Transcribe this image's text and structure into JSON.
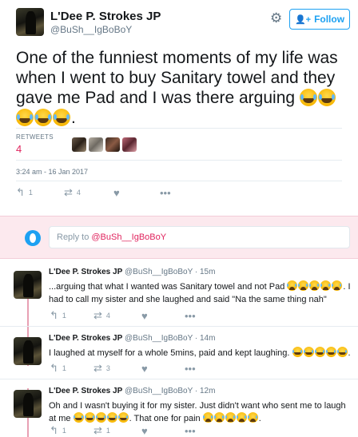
{
  "main_tweet": {
    "display_name": "L'Dee P. Strokes JP",
    "handle": "@BuSh__IgBoBoY",
    "follow_label": "Follow",
    "text_line": "One of the funniest moments of my life was when I went to buy Sanitary towel and they gave me Pad and I was there arguing",
    "text_end": ".",
    "retweets_label": "RETWEETS",
    "retweets_count": "4",
    "timestamp": "3:24 am - 16 Jan 2017",
    "actions": {
      "reply_count": "1",
      "retweet_count": "4",
      "like_count": "",
      "more": "•••"
    }
  },
  "reply_box": {
    "prefix": "Reply to",
    "mention": "@BuSh__IgBoBoY"
  },
  "replies": [
    {
      "name": "L'Dee P. Strokes JP",
      "meta": "@BuSh__IgBoBoY · 15m",
      "text_a": "...arguing that what I wanted was Sanitary towel and not Pad",
      "text_b": ". I had to call my sister and she laughed and said \"Na the same thing nah\"",
      "reply_count": "1",
      "retweet_count": "4",
      "like_count": "",
      "more": "•••"
    },
    {
      "name": "L'Dee P. Strokes JP",
      "meta": "@BuSh__IgBoBoY · 14m",
      "text_a": "I laughed at myself for a whole 5mins, paid and kept laughing.",
      "text_b": ".",
      "reply_count": "1",
      "retweet_count": "3",
      "like_count": "",
      "more": "•••"
    },
    {
      "name": "L'Dee P. Strokes JP",
      "meta": "@BuSh__IgBoBoY · 12m",
      "text_a": "Oh and I wasn't buying it for my sister. Just didn't want who sent me to laugh at me",
      "text_b": ". That one for pain",
      "text_c": ".",
      "reply_count": "1",
      "retweet_count": "1",
      "like_count": "",
      "more": "•••"
    }
  ],
  "icons": {
    "gear": "gear-icon",
    "follow": "add-user-icon",
    "reply": "reply-icon",
    "retweet": "retweet-icon",
    "like": "heart-icon",
    "more": "more-icon",
    "emoji_main": "tears-of-joy-emoji",
    "emoji_cry": "loudly-crying-emoji"
  },
  "colors": {
    "accent": "#1da1f2",
    "retweet_count": "#e0245e",
    "reply_bar_bg": "#fce9ee",
    "thread_line": "#e8a0b4"
  }
}
